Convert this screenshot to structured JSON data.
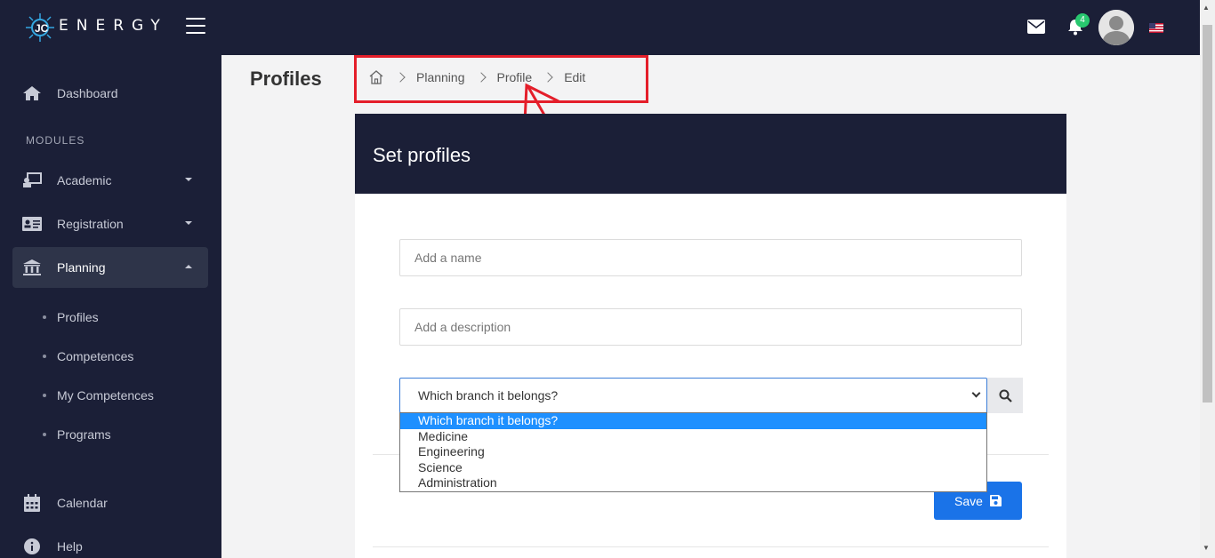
{
  "topbar": {
    "brand": "ENERGY",
    "notification_count": "4",
    "icons": [
      "menu-icon",
      "mail-icon",
      "bell-icon",
      "avatar",
      "us-flag-icon"
    ]
  },
  "sidebar": {
    "dashboard": "Dashboard",
    "modules_label": "MODULES",
    "items": [
      {
        "label": "Academic",
        "icon": "academic-icon"
      },
      {
        "label": "Registration",
        "icon": "id-card-icon"
      },
      {
        "label": "Planning",
        "icon": "bank-icon"
      }
    ],
    "planning_sub": [
      "Profiles",
      "Competences",
      "My Competences",
      "Programs"
    ],
    "calendar": "Calendar",
    "help": "Help"
  },
  "main": {
    "page_title": "Profiles",
    "breadcrumb": [
      "Planning",
      "Profile",
      "Edit"
    ],
    "card_title": "Set profiles",
    "name_placeholder": "Add a name",
    "description_placeholder": "Add a description",
    "branch_select": {
      "selected": "Which branch it belongs?",
      "options": [
        "Which branch it belongs?",
        "Medicine",
        "Engineering",
        "Science",
        "Administration"
      ]
    },
    "save_label": "Save"
  },
  "colors": {
    "navbar": "#1b1f37",
    "accent": "#1a73e8",
    "highlight": "#e41e2a",
    "badge": "#28c76f"
  }
}
